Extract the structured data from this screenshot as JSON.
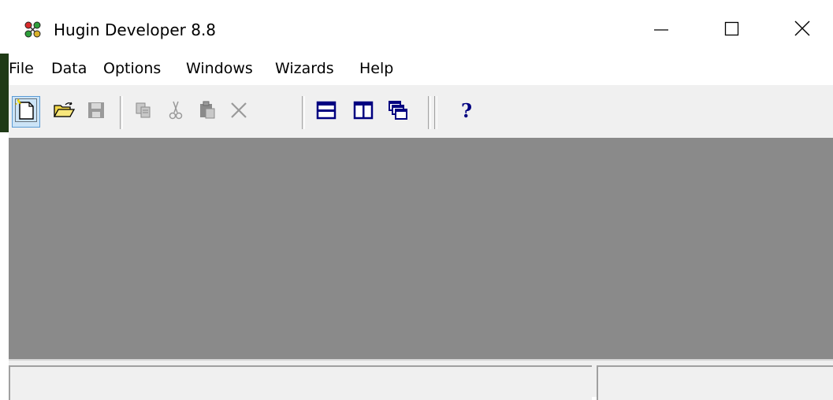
{
  "window": {
    "title": "Hugin Developer 8.8",
    "controls": {
      "minimize": "minimize-icon",
      "maximize": "maximize-icon",
      "close": "close-icon"
    }
  },
  "menu": {
    "items": [
      {
        "label": "File"
      },
      {
        "label": "Data"
      },
      {
        "label": "Options"
      },
      {
        "label": "Windows"
      },
      {
        "label": "Wizards"
      },
      {
        "label": "Help"
      }
    ]
  },
  "toolbar": {
    "buttons": [
      {
        "icon": "new-document-icon",
        "state": "hovered"
      },
      {
        "icon": "open-folder-icon",
        "state": "enabled"
      },
      {
        "icon": "save-icon",
        "state": "disabled"
      },
      {
        "icon": "copy-icon",
        "state": "disabled"
      },
      {
        "icon": "cut-icon",
        "state": "disabled"
      },
      {
        "icon": "paste-icon",
        "state": "disabled"
      },
      {
        "icon": "delete-icon",
        "state": "disabled"
      },
      {
        "icon": "tile-horizontal-icon",
        "state": "enabled"
      },
      {
        "icon": "tile-vertical-icon",
        "state": "enabled"
      },
      {
        "icon": "cascade-icon",
        "state": "enabled"
      },
      {
        "icon": "help-icon",
        "state": "enabled"
      }
    ]
  },
  "statusbar": {
    "panes": [
      {
        "text": ""
      },
      {
        "text": ""
      }
    ]
  },
  "colors": {
    "workspace": "#8a8a8a",
    "toolbar": "#f0f0f0",
    "accent_navy": "#000080",
    "disabled": "#a0a0a0"
  }
}
